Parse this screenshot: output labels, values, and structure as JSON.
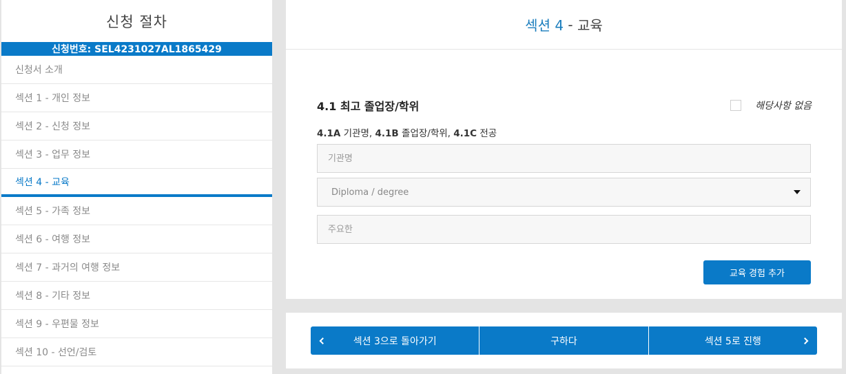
{
  "sidebar": {
    "title": "신청 절차",
    "app_number": "신청번호: SEL4231027AL1865429",
    "items": [
      {
        "label": "신청서 소개"
      },
      {
        "label": "섹션 1 - 개인 정보"
      },
      {
        "label": "섹션 2 - 신청 정보"
      },
      {
        "label": "섹션 3 - 업무 정보"
      },
      {
        "label": "섹션 4 - 교육"
      },
      {
        "label": "섹션 5 - 가족 정보"
      },
      {
        "label": "섹션 6 - 여행 정보"
      },
      {
        "label": "섹션 7 - 과거의 여행 정보"
      },
      {
        "label": "섹션 8 - 기타 정보"
      },
      {
        "label": "섹션 9 - 우편물 정보"
      },
      {
        "label": "섹션 10 - 선언/검토"
      }
    ]
  },
  "header": {
    "section": "섹션 4",
    "sep": " - ",
    "name": "교육"
  },
  "form": {
    "question": "4.1 최고 졸업장/학위",
    "not_applicable": "해당사항 없음",
    "sub": {
      "a_code": "4.1A",
      "a_text": " 기관명, ",
      "b_code": "4.1B",
      "b_text": " 졸업장/학위, ",
      "c_code": "4.1C",
      "c_text": " 전공"
    },
    "institution_placeholder": "기관명",
    "degree_value": "Diploma / degree",
    "major_placeholder": "주요한",
    "add_label": "교육 경험 추가"
  },
  "footer": {
    "back_label": "섹션 3으로 돌아가기",
    "save_label": "구하다",
    "next_label": "섹션 5로 진행"
  },
  "colors": {
    "primary": "#0a7ac8",
    "section_accent": "#1a7dbd"
  }
}
